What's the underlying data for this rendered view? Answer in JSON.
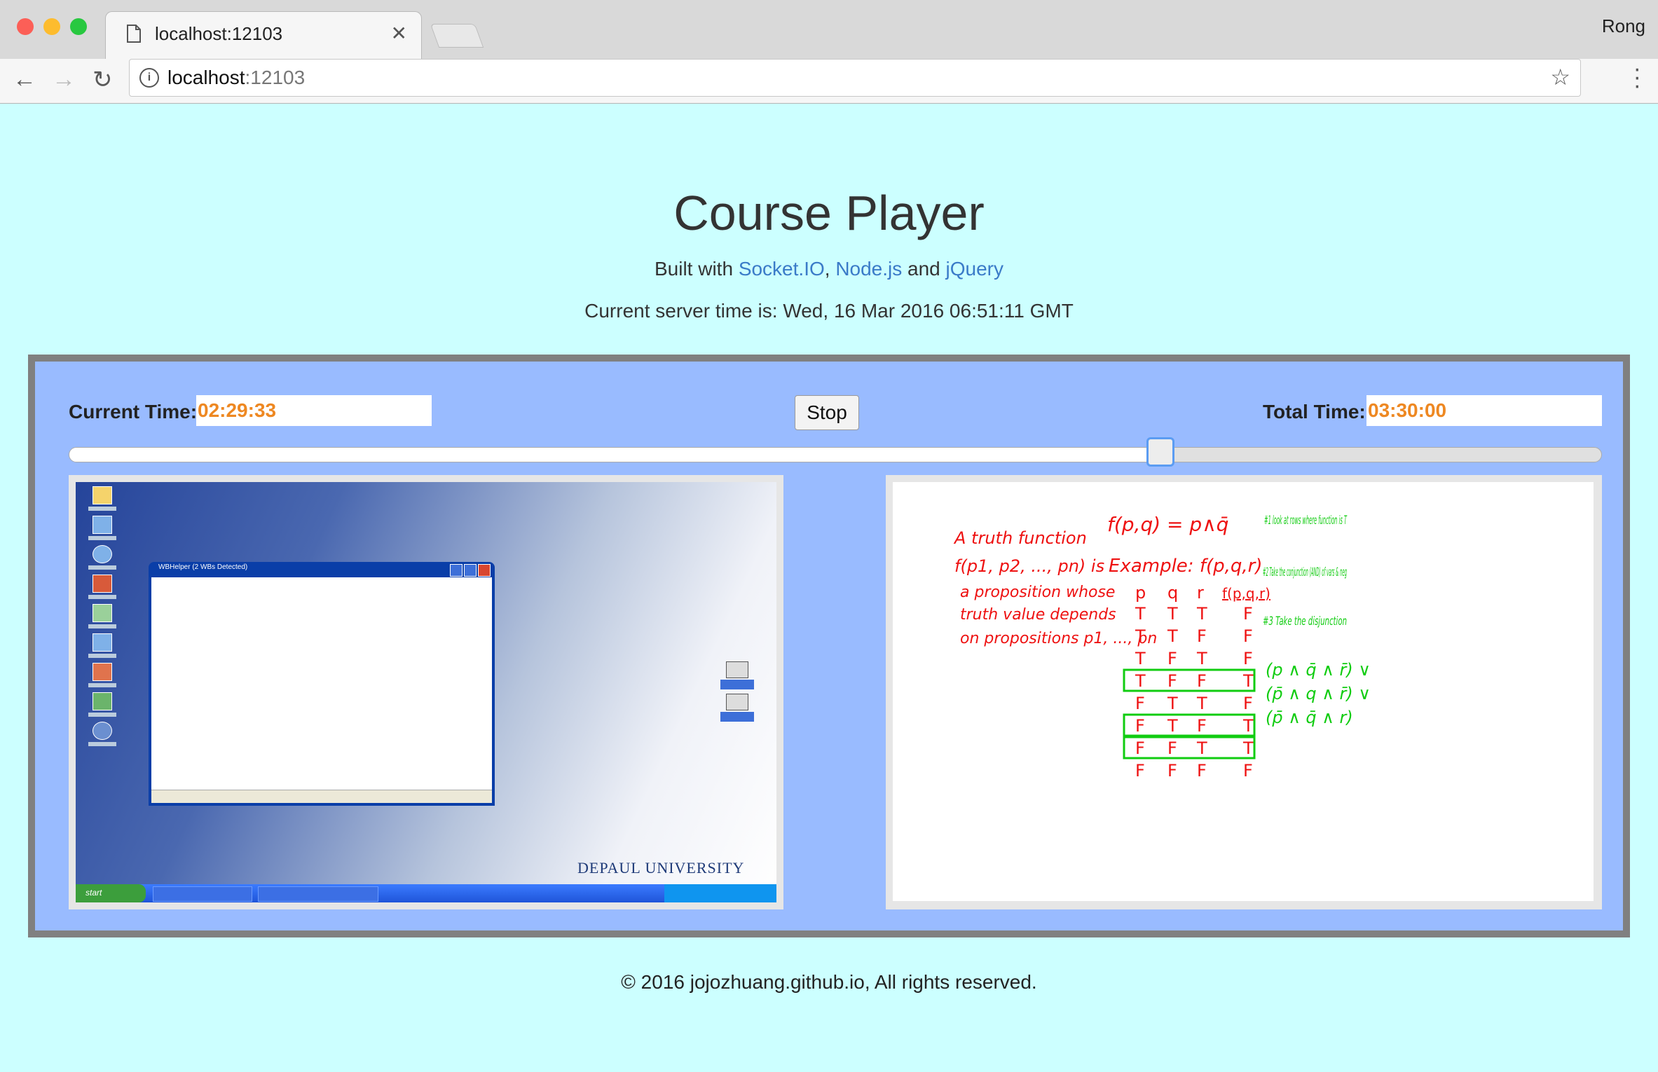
{
  "browser": {
    "tab_title": "localhost:12103",
    "url_host": "localhost",
    "url_port": ":12103",
    "profile_name": "Rong"
  },
  "page": {
    "title": "Course Player",
    "built_prefix": "Built with",
    "links": [
      "Socket.IO",
      "Node.js",
      "jQuery"
    ],
    "built_sep1": ",",
    "built_sep2": "and",
    "server_time": "Current server time is: Wed, 16 Mar 2016 06:51:11 GMT"
  },
  "player": {
    "current_time_label": "Current Time:",
    "current_time": "02:29:33",
    "stop_label": "Stop",
    "total_time_label": "Total Time:",
    "total_time": "03:30:00",
    "progress": 0.712
  },
  "desktop": {
    "window_title": "WBHelper (2 WBs Detected)",
    "logo_text": "DEPAUL UNIVERSITY",
    "start_label": "start"
  },
  "whiteboard": {
    "notes_left": [
      "A truth function",
      "f(p1, p2, ..., pn) is",
      "a proposition whose",
      "truth value depends",
      "on propositions p1, ..., pn"
    ],
    "formula": "f(p,q) = p∧q̄",
    "example": "Example: f(p,q,r)",
    "table_headers": [
      "p",
      "q",
      "r",
      "f(p,q,r)"
    ],
    "table_rows": [
      [
        "T",
        "T",
        "T",
        "F"
      ],
      [
        "T",
        "T",
        "F",
        "F"
      ],
      [
        "T",
        "F",
        "T",
        "F"
      ],
      [
        "T",
        "F",
        "F",
        "T"
      ],
      [
        "F",
        "T",
        "T",
        "F"
      ],
      [
        "F",
        "T",
        "F",
        "T"
      ],
      [
        "F",
        "F",
        "T",
        "T"
      ],
      [
        "F",
        "F",
        "F",
        "F"
      ]
    ],
    "steps": [
      "#1 look at rows where function is T",
      "#2 Take the conjunction (AND) of vars & neg",
      "#3 Take the disjunction"
    ],
    "terms": [
      "(p ∧ q̄ ∧ r̄) ∨",
      "(p̄ ∧ q ∧ r̄) ∨",
      "(p̄ ∧ q̄ ∧ r)"
    ],
    "red": "#ee1111",
    "green": "#11cc11"
  },
  "footer": {
    "text": "© 2016 jojozhuang.github.io, All rights reserved."
  }
}
